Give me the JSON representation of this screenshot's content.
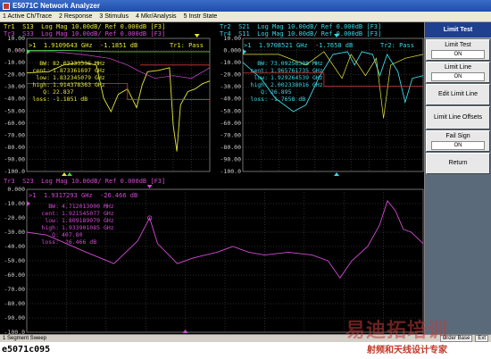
{
  "window": {
    "title": "E5071C Network Analyzer"
  },
  "menu": {
    "items": [
      "1 Active Ch/Trace",
      "2 Response",
      "3 Stimulus",
      "4 Mkr/Analysis",
      "5 Instr State"
    ]
  },
  "colors": {
    "tr1": "#e6e63a",
    "tr2": "#3ad8e6",
    "tr3": "#d24ad2",
    "tr_green": "#4ad24a",
    "grid": "#8a8a8a",
    "limit": "#d23a3a"
  },
  "channel1": {
    "header_line1": "Tr1  S13  Log Mag 10.00dB/ Ref 0.000dB [F3]",
    "header_line2": "Tr3  S33  Log Mag 10.00dB/ Ref 0.000dB [F3]",
    "pass_label": "Tr1: Pass",
    "marker_readout": ">1  1.9109643 GHz  -1.1851 dB",
    "stats": [
      {
        "label": "BW:",
        "value": "82.03333336 MHz"
      },
      {
        "label": "cent:",
        "value": "1.873361697 GHz"
      },
      {
        "label": "low:",
        "value": "1.832345079 GHz"
      },
      {
        "label": "high:",
        "value": "1.914378363 GHz"
      },
      {
        "label": "Q:",
        "value": "22.837"
      },
      {
        "label": "loss:",
        "value": "-1.1851 dB"
      }
    ],
    "y_ticks": [
      "10.00",
      "0.000",
      "-10.00",
      "-20.00",
      "-30.00",
      "-40.00",
      "-50.00",
      "-60.00",
      "-70.00",
      "-80.00",
      "-90.00",
      "-100.0"
    ]
  },
  "channel2": {
    "header_line1": "Tr2  S21  Log Mag 10.00dB/ Ref 0.000dB [F3]",
    "header_line2": "Tr4  S11  Log Mag 10.00dB/ Ref 0.000dB [F3]",
    "pass_label": "Tr2: Pass",
    "marker_readout": ">1  1.9708521 GHz  -1.7658 dB",
    "stats": [
      {
        "label": "BW:",
        "value": "73.09256308 MHz"
      },
      {
        "label": "cent:",
        "value": "1.965761735 GHz"
      },
      {
        "label": "low:",
        "value": "1.929264539 GHz"
      },
      {
        "label": "high:",
        "value": "2.002338016 GHz"
      },
      {
        "label": "Q:",
        "value": "26.895"
      },
      {
        "label": "loss:",
        "value": "-1.7658 dB"
      }
    ],
    "y_ticks": [
      "10.00",
      "0.000",
      "-10.00",
      "-20.00",
      "-30.00",
      "-40.00",
      "-50.00",
      "-60.00",
      "-70.00",
      "-80.00",
      "-90.00",
      "-100.0"
    ]
  },
  "channel3": {
    "header_line1": "Tr3  S23  Log Mag 10.00dB/ Ref 0.000dB [F3]",
    "marker_readout": ">1  1.9317293 GHz  -26.466 dB",
    "stats": [
      {
        "label": "BW:",
        "value": "4.712013000 MHz"
      },
      {
        "label": "cent:",
        "value": "1.921545077 GHz"
      },
      {
        "label": "low:",
        "value": "1.809189070 GHz"
      },
      {
        "label": "high:",
        "value": "1.933901085 GHz"
      },
      {
        "label": "Q:",
        "value": "407.80"
      },
      {
        "label": "loss:",
        "value": "-26.466 dB"
      }
    ],
    "y_ticks": [
      "0.000",
      "-10.00",
      "-20.00",
      "-30.00",
      "-40.00",
      "-50.00",
      "-60.00",
      "-70.00",
      "-80.00",
      "-90.00",
      "-100.0"
    ]
  },
  "softkeys": {
    "title": "Limit Test",
    "limit_test": {
      "label": "Limit Test",
      "value": "ON"
    },
    "limit_line": {
      "label": "Limit Line",
      "value": "ON"
    },
    "edit_limit_line": {
      "label": "Edit Limit Line"
    },
    "limit_line_offsets": {
      "label": "Limit Line Offsets"
    },
    "fail_sign": {
      "label": "Fail Sign",
      "value": "ON"
    },
    "return": {
      "label": "Return"
    }
  },
  "status": {
    "left": "1  Segment Sweep",
    "order": "Order Base",
    "extra": "Ext"
  },
  "caption": "e5071c095",
  "watermark": {
    "big": "易迪拓培训",
    "small": "射频和天线设计专家"
  }
}
